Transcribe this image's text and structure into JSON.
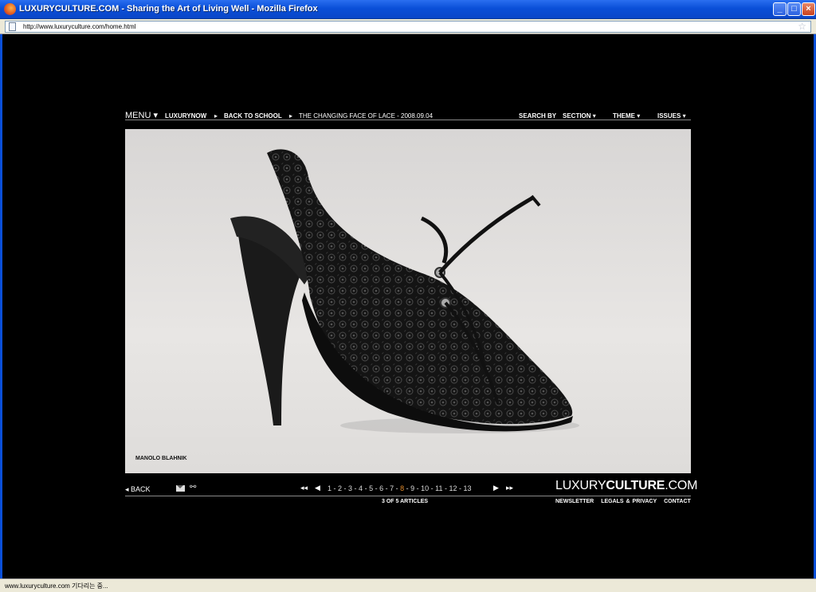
{
  "window": {
    "title": "LUXURYCULTURE.COM - Sharing the Art of Living Well - Mozilla Firefox",
    "url": "http://www.luxuryculture.com/home.html",
    "status": "www.luxuryculture.com 기다리는 중..."
  },
  "nav": {
    "menu": "MENU ▾",
    "luxurynow": "LUXURYNOW",
    "back_to_school": "BACK TO SCHOOL",
    "article": "THE CHANGING FACE OF LACE - 2008.09.04",
    "search_by": "SEARCH BY",
    "section": "SECTION ▾",
    "theme": "THEME ▾",
    "issues": "ISSUES ▾"
  },
  "photo": {
    "caption": "MANOLO BLAHNIK"
  },
  "bottom": {
    "back": "◂ BACK",
    "pages": [
      "1",
      "2",
      "3",
      "4",
      "5",
      "6",
      "7",
      "8",
      "9",
      "10",
      "11",
      "12",
      "13"
    ],
    "current_page": "8",
    "count": "3 OF 5 ARTICLES",
    "logo_light": "LUXURY",
    "logo_bold": "CULTURE",
    "logo_tail": ".COM",
    "newsletter": "NEWSLETTER",
    "legals": "LEGALS & PRIVACY",
    "contact": "CONTACT"
  }
}
